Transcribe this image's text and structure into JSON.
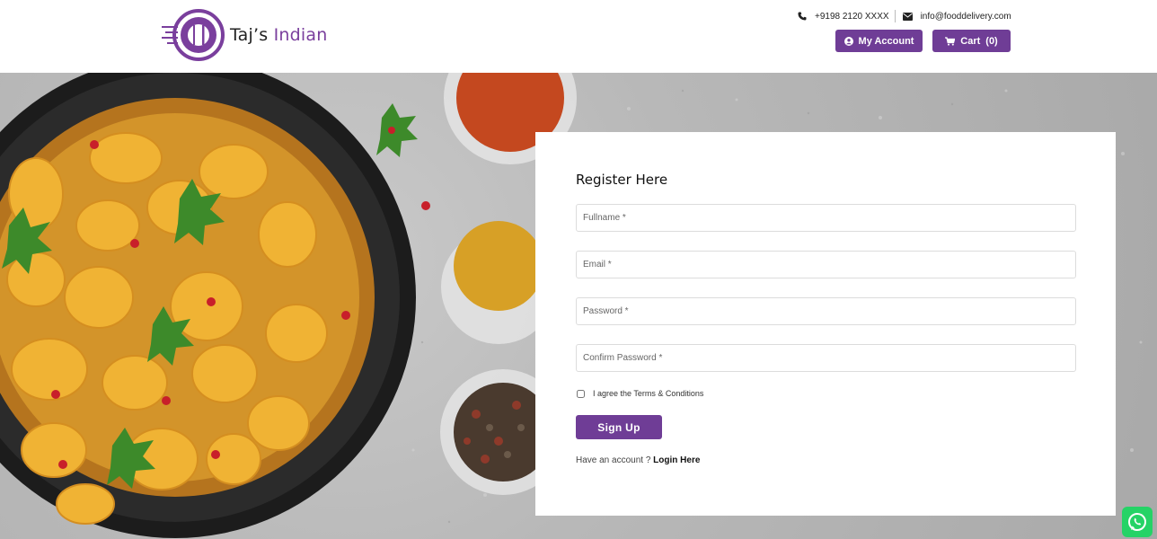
{
  "brand": {
    "name_part1": "Taj’s",
    "name_part2": "Indian",
    "accent_color": "#6f3d96"
  },
  "header": {
    "phone": "+9198 2120 XXXX",
    "email": "info@fooddelivery.com",
    "account_label": "My Account",
    "cart_label": "Cart",
    "cart_count": "(0)"
  },
  "icons": {
    "phone": "phone-icon",
    "email": "envelope-icon",
    "account": "user-circle-icon",
    "cart": "cart-icon",
    "whatsapp": "whatsapp-icon"
  },
  "form": {
    "title": "Register Here",
    "fullname_placeholder": "Fullname *",
    "email_placeholder": "Email *",
    "password_placeholder": "Password *",
    "confirm_placeholder": "Confirm Password *",
    "agree_label": "I agree the Terms & Conditions",
    "submit_label": "Sign Up",
    "have_account": "Have an account ?",
    "login_link": "Login Here"
  }
}
